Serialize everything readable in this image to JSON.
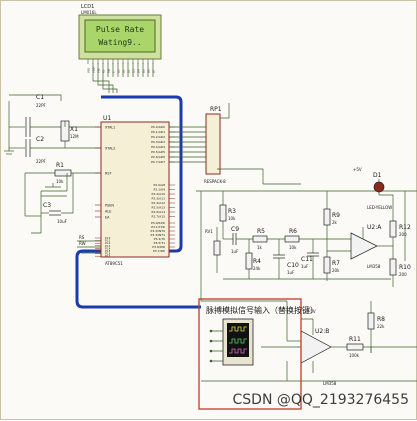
{
  "lcd": {
    "ref": "LCD1",
    "model": "LM016L",
    "line1": "Pulse Rate",
    "line2": "Wating9..",
    "pins": [
      "VSS",
      "VDD",
      "VEE",
      "RS",
      "RW",
      "E",
      "D0",
      "D1",
      "D2",
      "D3",
      "D4",
      "D5",
      "D6",
      "D7"
    ]
  },
  "crystal": {
    "c1": "C1",
    "c1_val": "22PF",
    "c2": "C2",
    "c2_val": "22PF",
    "x1": "X1",
    "x1_val": "12M"
  },
  "reset": {
    "r1": "R1",
    "r1_val": "10k",
    "c3": "C3",
    "c3_val": "10uF"
  },
  "mcu": {
    "ref": "U1",
    "model": "AT89C51",
    "left_pins": [
      "XTAL1",
      "XTAL2",
      "RST",
      "PSEN",
      "ALE",
      "EA"
    ],
    "left_port_pins": [
      "P1.0",
      "P1.1",
      "P1.2",
      "P1.3",
      "P1.4",
      "P1.5",
      "P1.6",
      "P1.7"
    ],
    "right_p0": [
      "P0.0/AD0",
      "P0.1/AD1",
      "P0.2/AD2",
      "P0.3/AD3",
      "P0.4/AD4",
      "P0.5/AD5",
      "P0.6/AD6",
      "P0.7/AD7"
    ],
    "right_p2": [
      "P2.0/A8",
      "P2.1/A9",
      "P2.2/A10",
      "P2.3/A11",
      "P2.4/A12",
      "P2.5/A13",
      "P2.6/A14",
      "P2.7/A15"
    ],
    "right_p3": [
      "P3.0/RXD",
      "P3.1/TXD",
      "P3.2/INT0",
      "P3.3/INT1",
      "P3.4/T0",
      "P3.5/T1",
      "P3.6/WR",
      "P3.7/RD"
    ]
  },
  "rp1": {
    "ref": "RP1",
    "model": "RESPACK-8"
  },
  "analog": {
    "vcc": "+5V",
    "d1": "D1",
    "d1_model": "LED-YELLOW",
    "r3": "R3",
    "r3_val": "10k",
    "rv1": "RV1",
    "c9": "C9",
    "c9_val": "1uF",
    "r4": "R4",
    "r4_val": "24k",
    "r5": "R5",
    "r5_val": "1k",
    "r6": "R6",
    "r6_val": "10k",
    "c10": "C10",
    "c10_val": "1uF",
    "c11": "C11",
    "c11_val": "1uF",
    "r7": "R7",
    "r7_val": "20k",
    "r9": "R9",
    "r9_val": "2k",
    "u2a": "U2:A",
    "u2a_model": "LM358",
    "r12": "R12",
    "r12_val": "200",
    "r10": "R10",
    "r10_val": "200",
    "r8": "R8",
    "r8_val": "22k",
    "u2b": "U2:B",
    "u2b_model": "LM358",
    "r11": "R11",
    "r11_val": "100k",
    "rv_plus": "+5V"
  },
  "signal_label": "脉搏模拟信号输入（替换按键）",
  "watermark": "CSDN @QQ_2193276455",
  "colors": {
    "wire": "#3a5f2a",
    "bus": "#1a3bb0",
    "lcd_bg": "#a9d56a",
    "lcd_text": "#1d3a10",
    "box": "#c23a2a",
    "chip_fill": "#f5efd6",
    "chip_stroke": "#8a2a20"
  }
}
